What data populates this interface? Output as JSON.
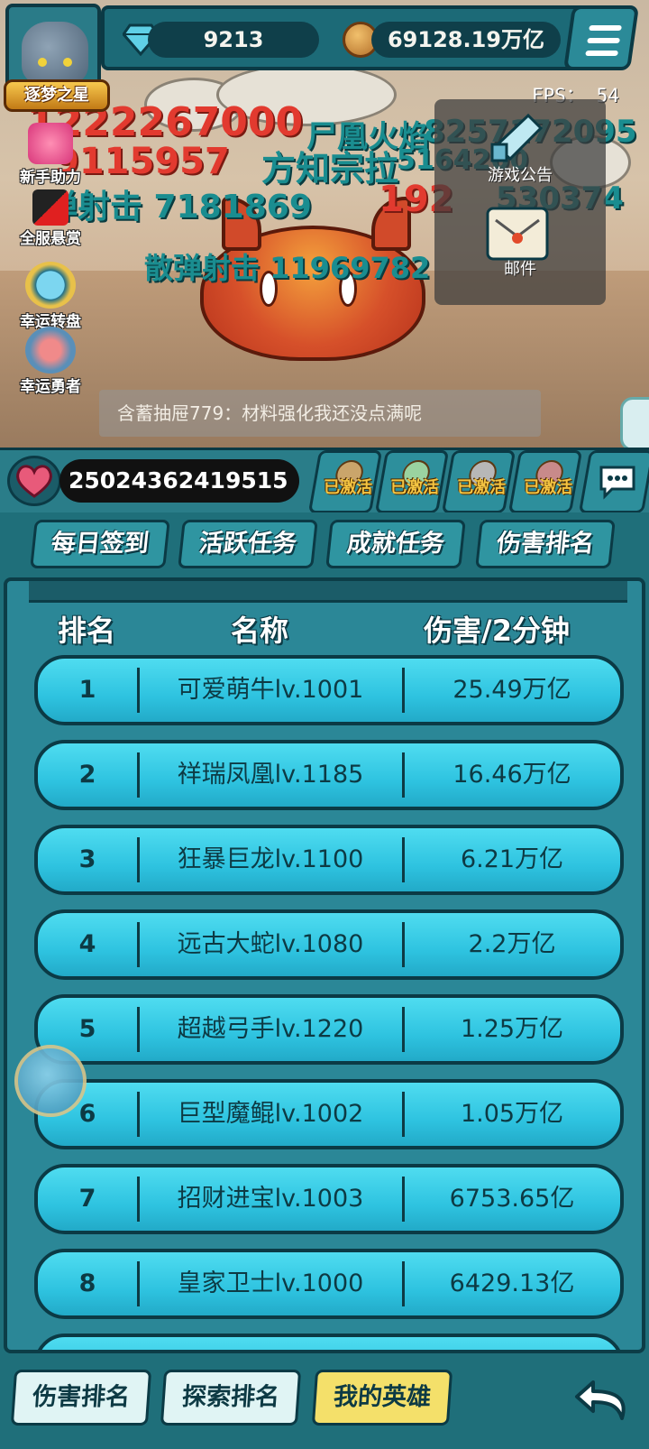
{
  "header": {
    "rank_badge": "逐梦之星",
    "gems": "9213",
    "gold": "69128.19万亿",
    "fps": "FPS： 54"
  },
  "battle": {
    "floating_texts": [
      {
        "text": "1222267000",
        "style": "red"
      },
      {
        "text": "尸凰火焰",
        "style": "teal"
      },
      {
        "text": "8257172095",
        "style": "teal"
      },
      {
        "text": "9115957",
        "style": "red"
      },
      {
        "text": "方知宗拉",
        "style": "teal"
      },
      {
        "text": "5164200",
        "style": "teal"
      },
      {
        "text": "弹射击 7181869",
        "style": "teal"
      },
      {
        "text": "192",
        "style": "red"
      },
      {
        "text": "530374",
        "style": "teal"
      },
      {
        "text": "散弹射击 11969782",
        "style": "teal"
      }
    ],
    "chat_message": "含蓄抽屉779：材料强化我还没点满呢"
  },
  "side_icons": [
    {
      "label": "新手助力",
      "icon": "gift-icon"
    },
    {
      "label": "全服悬赏",
      "icon": "bounty-icon"
    },
    {
      "label": "幸运转盘",
      "icon": "wheel-icon"
    },
    {
      "label": "幸运勇者",
      "icon": "hero-icon"
    }
  ],
  "notices": {
    "announcement": "游戏公告",
    "mail": "邮件"
  },
  "hp": {
    "value": "25024362419515"
  },
  "buffs": [
    {
      "label": "已激活"
    },
    {
      "label": "已激活"
    },
    {
      "label": "已激活"
    },
    {
      "label": "已激活"
    }
  ],
  "task_tabs": [
    "每日签到",
    "活跃任务",
    "成就任务",
    "伤害排名"
  ],
  "ranking": {
    "headers": {
      "rank": "排名",
      "name": "名称",
      "damage": "伤害/2分钟"
    },
    "rows": [
      {
        "rank": "1",
        "name": "可爱萌牛lv.1001",
        "damage": "25.49万亿"
      },
      {
        "rank": "2",
        "name": "祥瑞凤凰lv.1185",
        "damage": "16.46万亿"
      },
      {
        "rank": "3",
        "name": "狂暴巨龙lv.1100",
        "damage": "6.21万亿"
      },
      {
        "rank": "4",
        "name": "远古大蛇lv.1080",
        "damage": "2.2万亿"
      },
      {
        "rank": "5",
        "name": "超越弓手lv.1220",
        "damage": "1.25万亿"
      },
      {
        "rank": "6",
        "name": "巨型魔鲲lv.1002",
        "damage": "1.05万亿"
      },
      {
        "rank": "7",
        "name": "招财进宝lv.1003",
        "damage": "6753.65亿"
      },
      {
        "rank": "8",
        "name": "皇家卫士lv.1000",
        "damage": "6429.13亿"
      }
    ]
  },
  "bottom_tabs": [
    {
      "label": "伤害排名",
      "active": false
    },
    {
      "label": "探索排名",
      "active": false
    },
    {
      "label": "我的英雄",
      "active": true
    }
  ],
  "colors": {
    "panel": "#2b8797",
    "row": "#2ec3e0",
    "active_tab": "#f4e06a",
    "activated_text": "#f5c542"
  }
}
